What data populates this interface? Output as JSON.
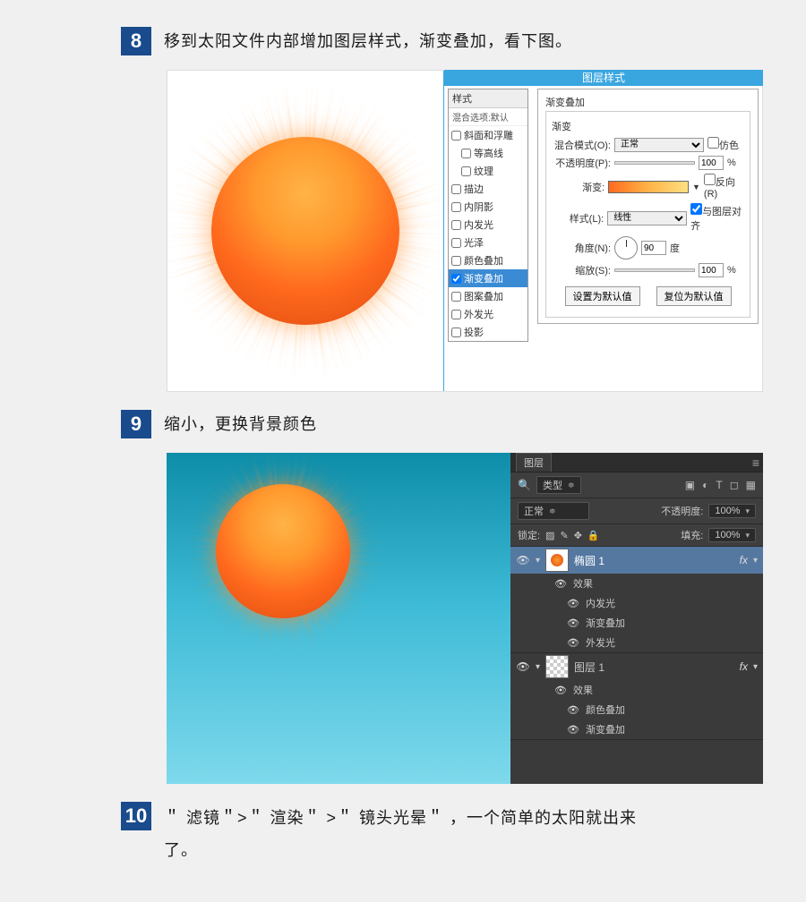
{
  "step8": {
    "num": "8",
    "text": "移到太阳文件内部增加图层样式，渐变叠加，看下图。",
    "panel_title": "图层样式",
    "styles_header": "样式",
    "blend_defaults": "混合选项:默认",
    "style_items": [
      {
        "label": "斜面和浮雕",
        "checked": false
      },
      {
        "label": "等高线",
        "checked": false,
        "indent": true
      },
      {
        "label": "纹理",
        "checked": false,
        "indent": true
      },
      {
        "label": "描边",
        "checked": false
      },
      {
        "label": "内阴影",
        "checked": false
      },
      {
        "label": "内发光",
        "checked": false
      },
      {
        "label": "光泽",
        "checked": false
      },
      {
        "label": "颜色叠加",
        "checked": false
      },
      {
        "label": "渐变叠加",
        "checked": true,
        "selected": true
      },
      {
        "label": "图案叠加",
        "checked": false
      },
      {
        "label": "外发光",
        "checked": false
      },
      {
        "label": "投影",
        "checked": false
      }
    ],
    "section_title": "渐变叠加",
    "subsection": "渐变",
    "blend_mode": {
      "label": "混合模式(O):",
      "value": "正常",
      "dither": "仿色"
    },
    "opacity": {
      "label": "不透明度(P):",
      "value": "100",
      "pct": "%"
    },
    "gradient": {
      "label": "渐变:",
      "reverse": "反向(R)"
    },
    "style": {
      "label": "样式(L):",
      "value": "线性",
      "align": "与图层对齐"
    },
    "angle": {
      "label": "角度(N):",
      "value": "90",
      "unit": "度"
    },
    "scale": {
      "label": "缩放(S):",
      "value": "100",
      "pct": "%"
    },
    "btn_default": "设置为默认值",
    "btn_reset": "复位为默认值"
  },
  "step9": {
    "num": "9",
    "text": "缩小，更换背景颜色",
    "panel": "图层",
    "filter_label": "类型",
    "mode": "正常",
    "opacity_label": "不透明度:",
    "opacity_value": "100%",
    "lock_label": "锁定:",
    "fill_label": "填充:",
    "fill_value": "100%",
    "layers": [
      {
        "name": "椭圆 1",
        "fx": "fx",
        "sun": true,
        "sel": true,
        "effects_label": "效果",
        "effects": [
          "内发光",
          "渐变叠加",
          "外发光"
        ]
      },
      {
        "name": "图层 1",
        "fx": "fx",
        "checker": true,
        "effects_label": "效果",
        "effects": [
          "颜色叠加",
          "渐变叠加"
        ]
      }
    ]
  },
  "step10": {
    "num": "10",
    "text": "＂ 滤镜＂>＂ 渲染＂ >＂ 镜头光晕＂ ，一个简单的太阳就出来了。"
  }
}
